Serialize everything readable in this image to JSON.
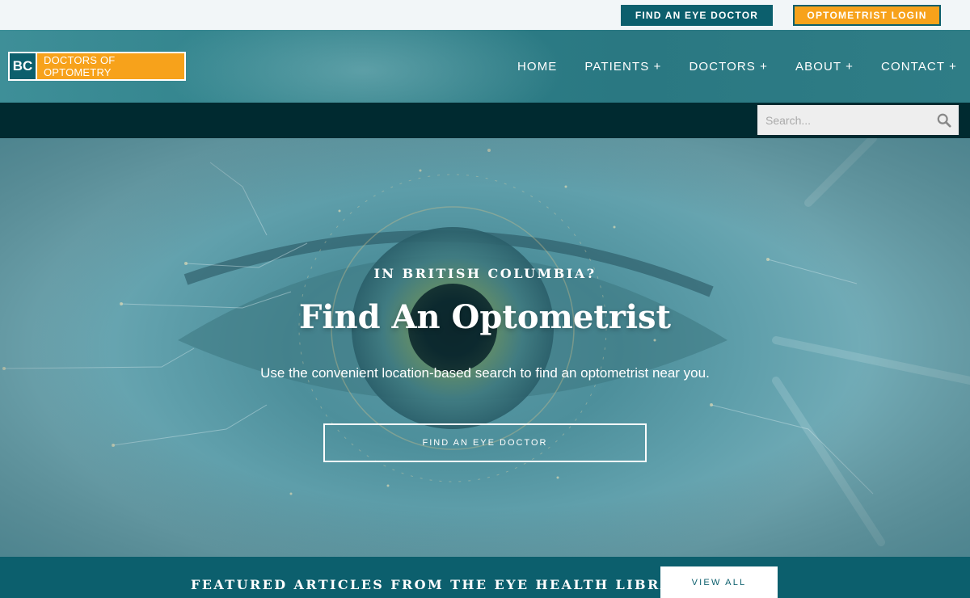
{
  "topbar": {
    "find_eye_doctor": "FIND AN EYE DOCTOR",
    "optometrist_login": "OPTOMETRIST LOGIN"
  },
  "logo": {
    "abbr": "BC",
    "name": "DOCTORS OF OPTOMETRY"
  },
  "nav": {
    "items": [
      "HOME",
      "PATIENTS +",
      "DOCTORS +",
      "ABOUT +",
      "CONTACT +"
    ]
  },
  "search": {
    "placeholder": "Search...",
    "icon": "search-icon"
  },
  "hero": {
    "eyebrow": "IN BRITISH COLUMBIA?",
    "title": "Find An Optometrist",
    "subtitle": "Use the convenient location-based search to find an optometrist near you.",
    "cta": "FIND AN EYE DOCTOR"
  },
  "featured": {
    "title": "FEATURED ARTICLES FROM THE EYE HEALTH LIBRARY",
    "view_all": "VIEW ALL"
  },
  "colors": {
    "teal": "#0c5f6d",
    "orange": "#f7a21b",
    "dark_strip": "#002a30",
    "topbar_bg": "#f2f6f8"
  }
}
